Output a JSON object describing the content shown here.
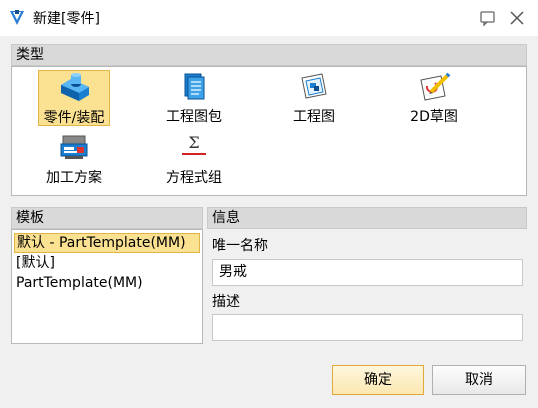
{
  "window": {
    "title": "新建[零件]",
    "icon": "zw3d-app-icon"
  },
  "type_section": {
    "header": "类型",
    "items": [
      {
        "label": "零件/装配",
        "icon": "part-assembly-icon",
        "selected": true
      },
      {
        "label": "工程图包",
        "icon": "drawing-package-icon",
        "selected": false
      },
      {
        "label": "工程图",
        "icon": "drawing-icon",
        "selected": false
      },
      {
        "label": "2D草图",
        "icon": "sketch-2d-icon",
        "selected": false
      },
      {
        "label": "加工方案",
        "icon": "machining-plan-icon",
        "selected": false
      },
      {
        "label": "方程式组",
        "icon": "equation-set-icon",
        "selected": false
      }
    ]
  },
  "template_section": {
    "header": "模板",
    "items": [
      "默认 - PartTemplate(MM)",
      "[默认]",
      "PartTemplate(MM)"
    ],
    "selected_index": 0
  },
  "info_section": {
    "header": "信息",
    "unique_name_label": "唯一名称",
    "unique_name_value": "男戒",
    "description_label": "描述",
    "description_value": ""
  },
  "buttons": {
    "ok": "确定",
    "cancel": "取消"
  },
  "colors": {
    "selection_fill": "#fbe192",
    "selection_border": "#e0b446",
    "header_bg": "#d9d9d9",
    "window_bg": "#f0f0f0"
  }
}
